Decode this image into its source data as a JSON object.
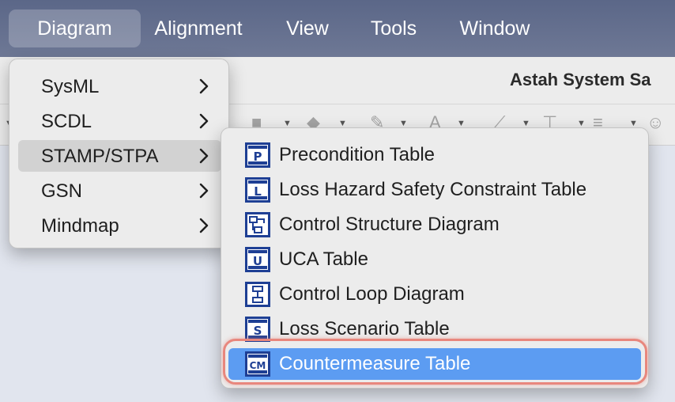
{
  "menubar": {
    "items": [
      {
        "label": "Diagram",
        "active": true
      },
      {
        "label": "Alignment"
      },
      {
        "label": "View"
      },
      {
        "label": "Tools"
      },
      {
        "label": "Window"
      }
    ]
  },
  "window": {
    "title": "Astah System Sa"
  },
  "diagram_menu": {
    "items": [
      {
        "label": "SysML",
        "submenu": true
      },
      {
        "label": "SCDL",
        "submenu": true
      },
      {
        "label": "STAMP/STPA",
        "submenu": true,
        "highlighted": true
      },
      {
        "label": "GSN",
        "submenu": true
      },
      {
        "label": "Mindmap",
        "submenu": true
      }
    ]
  },
  "stamp_submenu": {
    "items": [
      {
        "label": "Precondition Table",
        "icon": "precondition-table-icon",
        "icon_text": "P"
      },
      {
        "label": "Loss Hazard Safety Constraint Table",
        "icon": "loss-hazard-table-icon",
        "icon_text": "L"
      },
      {
        "label": "Control Structure Diagram",
        "icon": "control-structure-diagram-icon",
        "icon_text": ""
      },
      {
        "label": "UCA Table",
        "icon": "uca-table-icon",
        "icon_text": "U"
      },
      {
        "label": "Control Loop Diagram",
        "icon": "control-loop-diagram-icon",
        "icon_text": ""
      },
      {
        "label": "Loss Scenario Table",
        "icon": "loss-scenario-table-icon",
        "icon_text": "S"
      },
      {
        "label": "Countermeasure Table",
        "icon": "countermeasure-table-icon",
        "icon_text": "CM",
        "selected": true
      }
    ]
  },
  "colors": {
    "selection": "#5c9cf2",
    "highlight_ring": "#e8877d",
    "icon_blue": "#1e3f94"
  }
}
